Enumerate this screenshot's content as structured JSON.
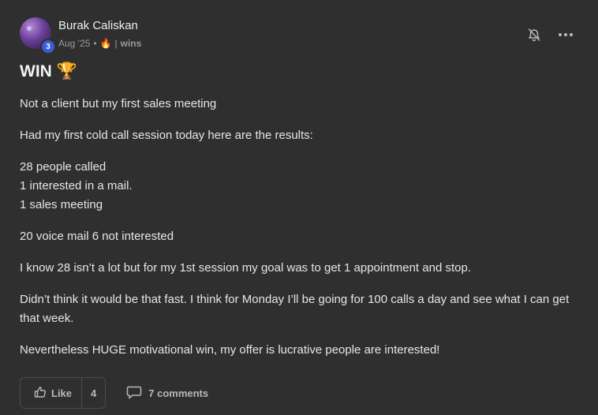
{
  "author": {
    "name": "Burak Caliskan",
    "level": "3"
  },
  "meta": {
    "date": "Aug '25",
    "separator": "•",
    "divider": "|",
    "category": "wins"
  },
  "post": {
    "title": "WIN 🏆",
    "paragraphs": [
      [
        "Not a client but my first sales meeting"
      ],
      [
        "Had my first cold call session today here are the results:"
      ],
      [
        "28 people called",
        "1 interested in a mail.",
        "1 sales meeting"
      ],
      [
        "20 voice mail 6 not interested"
      ],
      [
        "I know 28 isn’t a lot but for my 1st session my goal was to get 1 appointment and stop."
      ],
      [
        "Didn’t think it would be that fast. I think for Monday I’ll be going for 100 calls a day and see what I can get that week."
      ],
      [
        "Nevertheless HUGE motivational win, my offer is lucrative people are interested!"
      ]
    ]
  },
  "actions": {
    "like_label": "Like",
    "like_count": "4",
    "comments_label": "7 comments"
  },
  "icons": {
    "notification": "bell-off-icon",
    "more": "more-horizontal-icon",
    "like": "thumbs-up-icon",
    "comment": "comment-icon",
    "fire": "fire-icon"
  }
}
